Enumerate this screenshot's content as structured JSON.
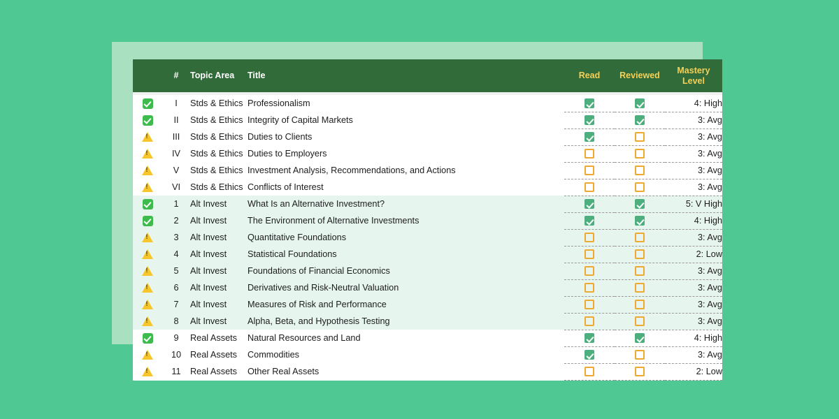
{
  "theme": {
    "page_background": "#4fc894",
    "accent_panel": "#a8e0c0",
    "header_background": "#306b39",
    "header_text": "#ffffff",
    "header_accent_text": "#f7cf55",
    "row_highlight": "#e6f5ee",
    "checkbox_on": "#4caf7d",
    "checkbox_off_border": "#f0a830",
    "mastery_high": "#43c08a",
    "mastery_avg": "#f5a623",
    "mastery_low": "#e2607a"
  },
  "table": {
    "columns": {
      "status": "",
      "number": "#",
      "topic_area": "Topic Area",
      "title": "Title",
      "read": "Read",
      "reviewed": "Reviewed",
      "mastery_level_line1": "Mastery",
      "mastery_level_line2": "Level"
    },
    "icons": {
      "complete": "check-box-icon",
      "incomplete": "warning-triangle-icon",
      "dropdown": "chevron-down-icon"
    },
    "rows": [
      {
        "status": "complete",
        "number": "I",
        "topic_area": "Stds & Ethics",
        "title": "Professionalism",
        "read": true,
        "reviewed": true,
        "mastery": "4: High",
        "mastery_class": "m-high",
        "highlighted": false
      },
      {
        "status": "complete",
        "number": "II",
        "topic_area": "Stds & Ethics",
        "title": "Integrity of Capital Markets",
        "read": true,
        "reviewed": true,
        "mastery": "3: Avg",
        "mastery_class": "m-avg",
        "highlighted": false
      },
      {
        "status": "incomplete",
        "number": "III",
        "topic_area": "Stds & Ethics",
        "title": "Duties to Clients",
        "read": true,
        "reviewed": false,
        "mastery": "3: Avg",
        "mastery_class": "m-avg",
        "highlighted": false
      },
      {
        "status": "incomplete",
        "number": "IV",
        "topic_area": "Stds & Ethics",
        "title": "Duties to Employers",
        "read": false,
        "reviewed": false,
        "mastery": "3: Avg",
        "mastery_class": "m-avg",
        "highlighted": false
      },
      {
        "status": "incomplete",
        "number": "V",
        "topic_area": "Stds & Ethics",
        "title": "Investment Analysis, Recommendations, and Actions",
        "read": false,
        "reviewed": false,
        "mastery": "3: Avg",
        "mastery_class": "m-avg",
        "highlighted": false
      },
      {
        "status": "incomplete",
        "number": "VI",
        "topic_area": "Stds & Ethics",
        "title": "Conflicts of Interest",
        "read": false,
        "reviewed": false,
        "mastery": "3: Avg",
        "mastery_class": "m-avg",
        "highlighted": false
      },
      {
        "status": "complete",
        "number": "1",
        "topic_area": "Alt Invest",
        "title": "What Is an Alternative Investment?",
        "read": true,
        "reviewed": true,
        "mastery": "5: V High",
        "mastery_class": "m-high",
        "highlighted": true
      },
      {
        "status": "complete",
        "number": "2",
        "topic_area": "Alt Invest",
        "title": "The Environment of Alternative Investments",
        "read": true,
        "reviewed": true,
        "mastery": "4: High",
        "mastery_class": "m-high",
        "highlighted": true
      },
      {
        "status": "incomplete",
        "number": "3",
        "topic_area": "Alt Invest",
        "title": "Quantitative Foundations",
        "read": false,
        "reviewed": false,
        "mastery": "3: Avg",
        "mastery_class": "m-avg",
        "highlighted": true
      },
      {
        "status": "incomplete",
        "number": "4",
        "topic_area": "Alt Invest",
        "title": "Statistical Foundations",
        "read": false,
        "reviewed": false,
        "mastery": "2: Low",
        "mastery_class": "m-low",
        "highlighted": true
      },
      {
        "status": "incomplete",
        "number": "5",
        "topic_area": "Alt Invest",
        "title": "Foundations of Financial Economics",
        "read": false,
        "reviewed": false,
        "mastery": "3: Avg",
        "mastery_class": "m-avg",
        "highlighted": true
      },
      {
        "status": "incomplete",
        "number": "6",
        "topic_area": "Alt Invest",
        "title": "Derivatives and Risk-Neutral Valuation",
        "read": false,
        "reviewed": false,
        "mastery": "3: Avg",
        "mastery_class": "m-avg",
        "highlighted": true
      },
      {
        "status": "incomplete",
        "number": "7",
        "topic_area": "Alt Invest",
        "title": "Measures of Risk and Performance",
        "read": false,
        "reviewed": false,
        "mastery": "3: Avg",
        "mastery_class": "m-avg",
        "highlighted": true
      },
      {
        "status": "incomplete",
        "number": "8",
        "topic_area": "Alt Invest",
        "title": "Alpha, Beta, and Hypothesis Testing",
        "read": false,
        "reviewed": false,
        "mastery": "3: Avg",
        "mastery_class": "m-avg",
        "highlighted": true
      },
      {
        "status": "complete",
        "number": "9",
        "topic_area": "Real Assets",
        "title": "Natural Resources and Land",
        "read": true,
        "reviewed": true,
        "mastery": "4: High",
        "mastery_class": "m-high",
        "highlighted": false
      },
      {
        "status": "incomplete",
        "number": "10",
        "topic_area": "Real Assets",
        "title": "Commodities",
        "read": true,
        "reviewed": false,
        "mastery": "3: Avg",
        "mastery_class": "m-avg",
        "highlighted": false
      },
      {
        "status": "incomplete",
        "number": "11",
        "topic_area": "Real Assets",
        "title": "Other Real Assets",
        "read": false,
        "reviewed": false,
        "mastery": "2: Low",
        "mastery_class": "m-low",
        "highlighted": false
      }
    ]
  }
}
